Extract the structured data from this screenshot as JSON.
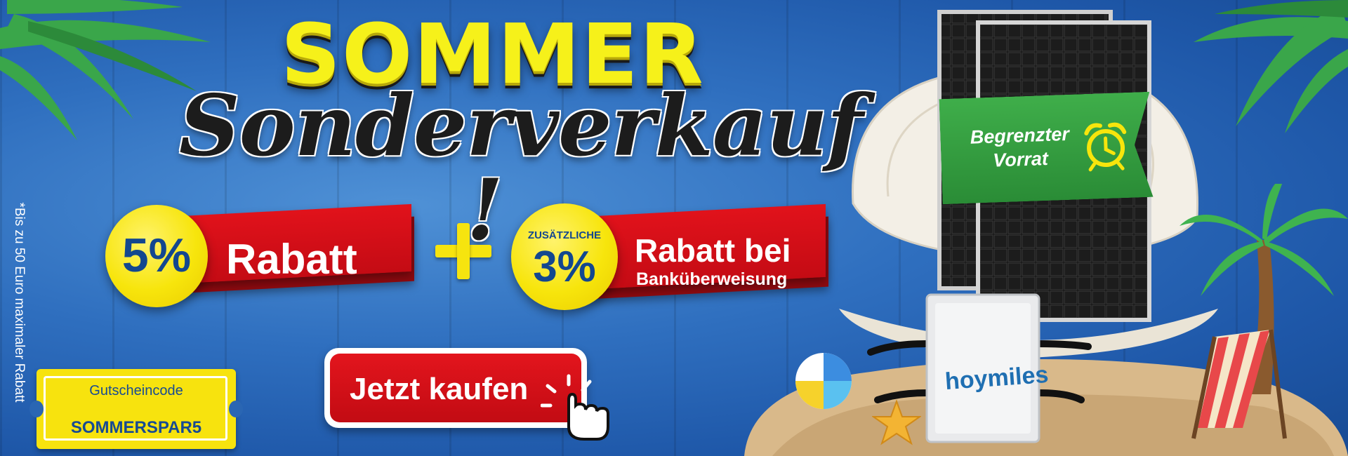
{
  "title": {
    "line1": "SOMMER",
    "line2": "Sonderverkauf !"
  },
  "offers": [
    {
      "percent": "5%",
      "label": "Rabatt"
    },
    {
      "extra": "ZUSÄTZLICHE",
      "percent": "3%",
      "label_line1": "Rabatt bei",
      "label_line2": "Banküberweisung"
    }
  ],
  "side_note": "*Bis zu 50 Euro maximaler Rabatt",
  "cta": {
    "label": "Jetzt kaufen"
  },
  "coupon": {
    "label": "Gutscheincode",
    "code": "SOMMERSPAR5"
  },
  "badge": {
    "line1": "Begrenzter",
    "line2": "Vorrat",
    "icon": "alarm-clock-icon"
  },
  "product": {
    "brand": "hoymiles"
  },
  "colors": {
    "background": "#2f6fbf",
    "ribbon_red": "#d4101a",
    "badge_yellow": "#f7e50c",
    "badge_green": "#2f9a3c",
    "title_yellow": "#f6f11a"
  }
}
